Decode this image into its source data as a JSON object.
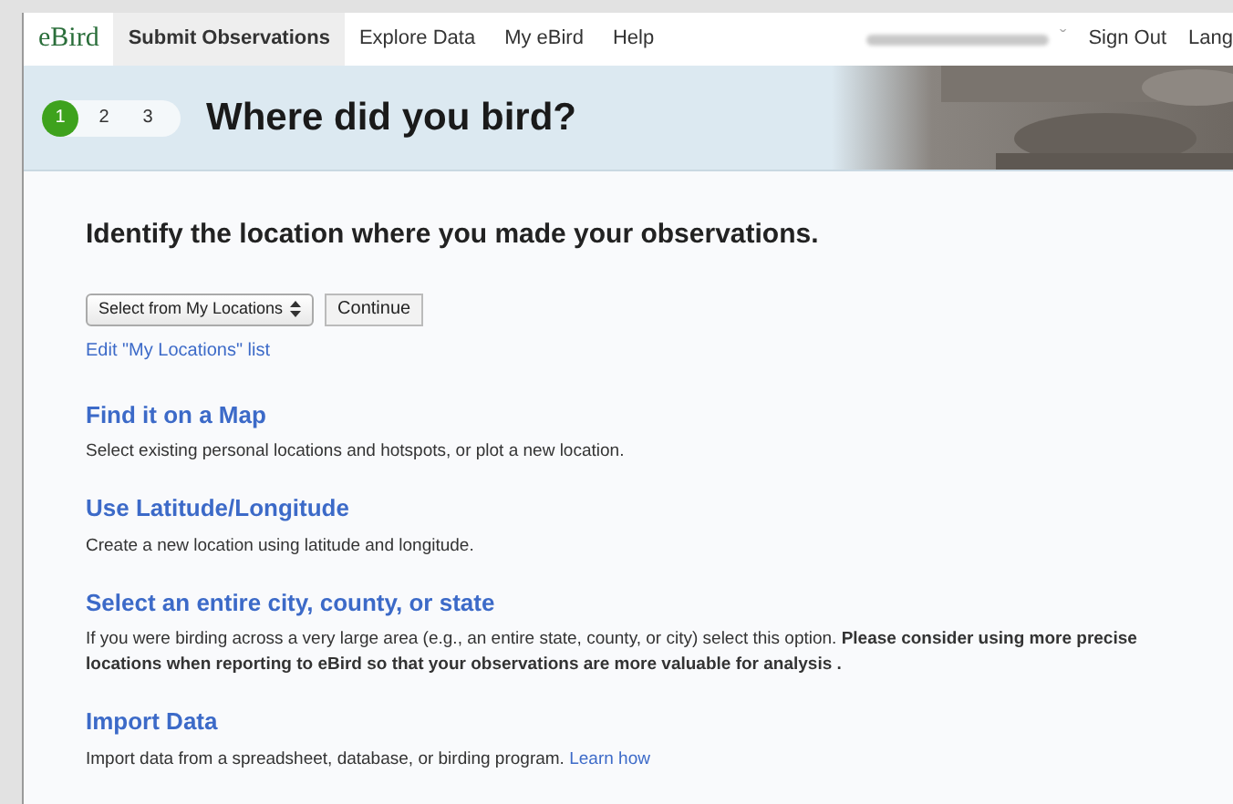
{
  "nav": {
    "logo": "eBird",
    "items": [
      {
        "label": "Submit Observations",
        "selected": true
      },
      {
        "label": "Explore Data",
        "selected": false
      },
      {
        "label": "My eBird",
        "selected": false
      },
      {
        "label": "Help",
        "selected": false
      }
    ],
    "caret": "ˇ",
    "sign_out": "Sign Out",
    "language": "Lang"
  },
  "header": {
    "steps": [
      {
        "label": "1",
        "selected": true
      },
      {
        "label": "2",
        "selected": false
      },
      {
        "label": "3",
        "selected": false
      }
    ],
    "title": "Where did you bird?"
  },
  "heading": "Identify the location where you made your observations.",
  "location_select": {
    "value": "Select from My Locations"
  },
  "continue_button": "Continue",
  "edit_link": "Edit \"My Locations\" list",
  "options": [
    {
      "title": "Find it on a Map",
      "description": "Select existing personal locations and hotspots, or plot a new location."
    },
    {
      "title": "Use Latitude/Longitude",
      "description": "Create a new location using latitude and longitude."
    },
    {
      "title": "Select an entire city, county, or state",
      "description": "If you were birding across a very large area (e.g., an entire state, county, or city) select this option. **Please consider using more precise locations when reporting to eBird so that your observations are more valuable for analysis .**"
    },
    {
      "title": "Import Data",
      "description": "Import data from a spreadsheet, database, or birding program.",
      "link": "Learn how"
    }
  ]
}
